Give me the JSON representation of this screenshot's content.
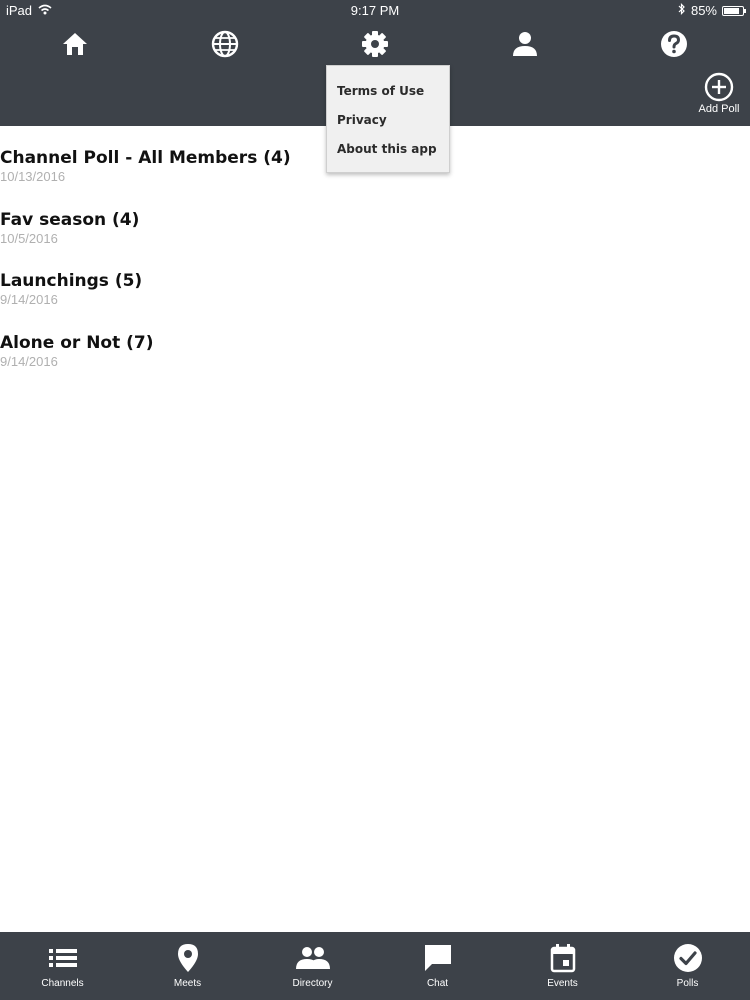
{
  "status_bar": {
    "device": "iPad",
    "time": "9:17 PM",
    "battery": "85%",
    "battery_level": 0.85,
    "icons": [
      "wifi-icon",
      "bluetooth-icon",
      "battery-icon"
    ]
  },
  "header": {
    "nav_icons": [
      "home-icon",
      "globe-icon",
      "gear-icon",
      "person-icon",
      "help-icon"
    ],
    "add_poll_label": "Add Poll"
  },
  "settings_menu": {
    "items": [
      "Terms of Use",
      "Privacy",
      "About this app"
    ]
  },
  "polls": [
    {
      "title": "Channel Poll - All Members (4)",
      "date": "10/13/2016"
    },
    {
      "title": "Fav season (4)",
      "date": "10/5/2016"
    },
    {
      "title": "Launchings (5)",
      "date": "9/14/2016"
    },
    {
      "title": "Alone or Not (7)",
      "date": "9/14/2016"
    }
  ],
  "tabs": [
    {
      "label": "Channels",
      "icon": "list-icon"
    },
    {
      "label": "Meets",
      "icon": "location-pin-icon"
    },
    {
      "label": "Directory",
      "icon": "people-icon"
    },
    {
      "label": "Chat",
      "icon": "chat-bubble-icon"
    },
    {
      "label": "Events",
      "icon": "calendar-icon"
    },
    {
      "label": "Polls",
      "icon": "checkmark-circle-icon"
    }
  ],
  "colors": {
    "bar_background": "#3d4249",
    "icon": "#ffffff",
    "menu_background": "#f0f0f0",
    "date_text": "#b0b0b0"
  }
}
